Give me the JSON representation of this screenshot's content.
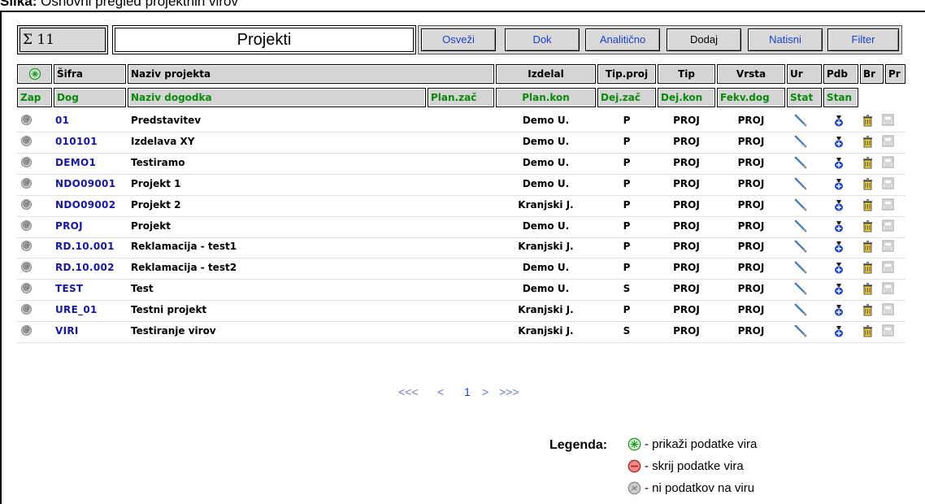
{
  "caption": {
    "prefix": "Slika:",
    "text": "Osnovni pregled projektnih virov"
  },
  "header": {
    "count": "Σ 11",
    "title": "Projekti"
  },
  "buttons": {
    "osvezi": "Osveži",
    "dok": "Dok",
    "analiticno": "Analitično",
    "dodaj": "Dodaj",
    "natisni": "Natisni",
    "filter": "Filter"
  },
  "columns_row1": {
    "sifra": "Šifra",
    "naziv": "Naziv projekta",
    "izdelal": "Izdelal",
    "tip_proj": "Tip.proj",
    "tip": "Tip",
    "vrsta": "Vrsta",
    "ur": "Ur",
    "pdb": "Pdb",
    "br": "Br",
    "pr": "Pr"
  },
  "columns_row2": {
    "zap": "Zap",
    "dog": "Dog",
    "naziv_dogodka": "Naziv dogodka",
    "plan_zac": "Plan.zač",
    "plan_kon": "Plan.kon",
    "dej_zac": "Dej.zač",
    "dej_kon": "Dej.kon",
    "fekv_dog": "Fekv.dog",
    "stat": "Stat",
    "stan": "Stan"
  },
  "rows": [
    {
      "code": "01",
      "name": "Predstavitev",
      "author": "Demo U.",
      "tip_proj": "P",
      "tip": "PROJ",
      "vrsta": "PROJ"
    },
    {
      "code": "010101",
      "name": "Izdelava XY",
      "author": "Demo U.",
      "tip_proj": "P",
      "tip": "PROJ",
      "vrsta": "PROJ"
    },
    {
      "code": "DEMO1",
      "name": "Testiramo",
      "author": "Demo U.",
      "tip_proj": "P",
      "tip": "PROJ",
      "vrsta": "PROJ"
    },
    {
      "code": "NDO09001",
      "name": "Projekt 1",
      "author": "Demo U.",
      "tip_proj": "P",
      "tip": "PROJ",
      "vrsta": "PROJ"
    },
    {
      "code": "NDO09002",
      "name": "Projekt 2",
      "author": "Kranjski J.",
      "tip_proj": "P",
      "tip": "PROJ",
      "vrsta": "PROJ"
    },
    {
      "code": "PROJ",
      "name": "Projekt",
      "author": "Demo U.",
      "tip_proj": "P",
      "tip": "PROJ",
      "vrsta": "PROJ"
    },
    {
      "code": "RD.10.001",
      "name": "Reklamacija - test1",
      "author": "Kranjski J.",
      "tip_proj": "P",
      "tip": "PROJ",
      "vrsta": "PROJ"
    },
    {
      "code": "RD.10.002",
      "name": "Reklamacija - test2",
      "author": "Demo U.",
      "tip_proj": "P",
      "tip": "PROJ",
      "vrsta": "PROJ"
    },
    {
      "code": "TEST",
      "name": "Test",
      "author": "Demo U.",
      "tip_proj": "S",
      "tip": "PROJ",
      "vrsta": "PROJ"
    },
    {
      "code": "URE_01",
      "name": "Testni projekt",
      "author": "Kranjski J.",
      "tip_proj": "P",
      "tip": "PROJ",
      "vrsta": "PROJ"
    },
    {
      "code": "VIRI",
      "name": "Testiranje virov",
      "author": "Kranjski J.",
      "tip_proj": "S",
      "tip": "PROJ",
      "vrsta": "PROJ"
    }
  ],
  "pager": {
    "first": "<<<",
    "prev": "<",
    "page": "1",
    "next": ">",
    "last": ">>>"
  },
  "legend": {
    "title": "Legenda:",
    "items": [
      {
        "icon": "show-data-icon",
        "color": "#3cb83c",
        "text": "- prikaži podatke vira"
      },
      {
        "icon": "hide-data-icon",
        "color": "#e25555",
        "text": "- skrij podatke vira"
      },
      {
        "icon": "no-data-icon",
        "color": "#a8a8a8",
        "text": "- ni podatkov na viru"
      }
    ]
  }
}
